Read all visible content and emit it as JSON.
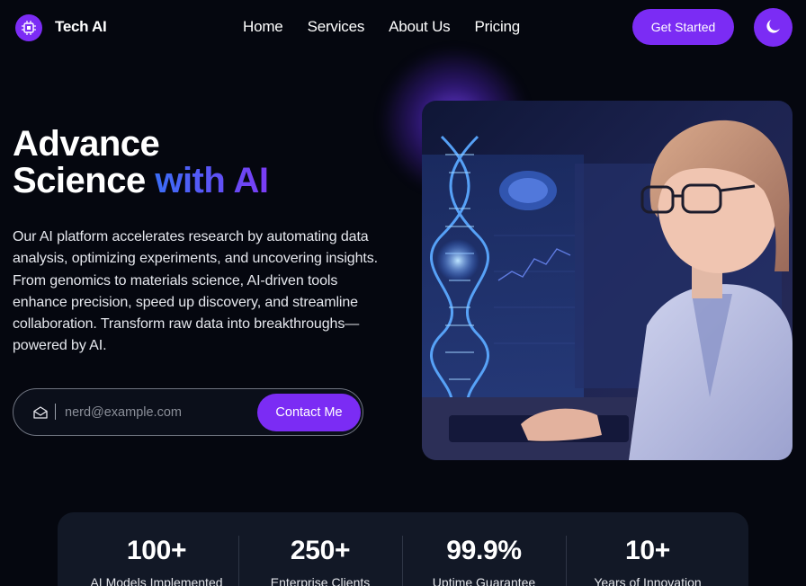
{
  "brand": {
    "name": "Tech AI",
    "logo_icon": "chip-icon"
  },
  "nav": {
    "links": [
      "Home",
      "Services",
      "About Us",
      "Pricing"
    ],
    "cta_label": "Get Started",
    "theme_icon": "moon-icon"
  },
  "hero": {
    "title_line1": "Advance",
    "title_line2_plain": "Science ",
    "title_line2_highlight": "with AI",
    "description": "Our AI platform accelerates research by automating data analysis, optimizing experiments, and uncovering insights. From genomics to materials science, AI-driven tools enhance precision, speed up discovery, and streamline collaboration. Transform raw data into breakthroughs—powered by AI.",
    "email": {
      "placeholder": "nerd@example.com",
      "value": "",
      "icon": "mail-icon"
    },
    "contact_label": "Contact Me"
  },
  "stats": [
    {
      "value": "100+",
      "label": "AI Models Implemented"
    },
    {
      "value": "250+",
      "label": "Enterprise Clients"
    },
    {
      "value": "99.9%",
      "label": "Uptime Guarantee"
    },
    {
      "value": "10+",
      "label": "Years of Innovation"
    }
  ],
  "colors": {
    "background": "#05070f",
    "accent": "#7b2cf4",
    "gradient_start": "#3b6df6",
    "gradient_end": "#7b3cf5",
    "stats_panel": "#121826"
  }
}
